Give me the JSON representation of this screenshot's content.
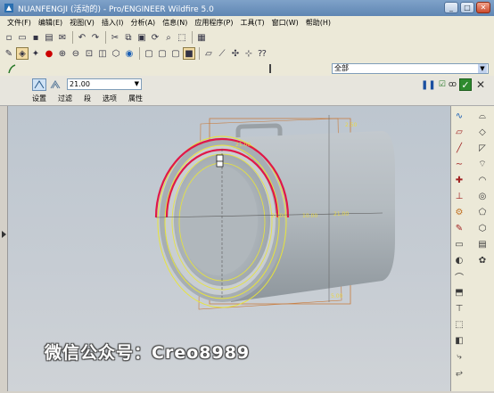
{
  "window": {
    "title": "NUANFENGJI (活动的) - Pro/ENGINEER Wildfire 5.0",
    "minimize": "_",
    "maximize": "□",
    "close": "✕"
  },
  "menu": [
    "文件(F)",
    "编辑(E)",
    "视图(V)",
    "插入(I)",
    "分析(A)",
    "信息(N)",
    "应用程序(P)",
    "工具(T)",
    "窗口(W)",
    "帮助(H)"
  ],
  "filter": {
    "value": "全部"
  },
  "dashboard": {
    "value": "21.00",
    "tabs": [
      "设置",
      "过滤",
      "段",
      "选项",
      "属性"
    ]
  },
  "viewport": {
    "dims": {
      "d1": "21.00",
      "d2": "21.00",
      "d3": "10.00",
      "d4": "21.00",
      "d5": "2.50",
      "d6": "5.00"
    }
  },
  "watermark": "微信公众号：Creo8989",
  "colors": {
    "titlebar": "#5f86b3",
    "model": "#a9b0b6",
    "highlight": "#e01848",
    "sketch": "#e8e43a",
    "datum": "#c87a3a",
    "ok": "#2e8b2e"
  },
  "icons": [
    "new-icon",
    "open-icon",
    "save-icon",
    "print-icon",
    "email-icon",
    "undo-icon",
    "redo-icon",
    "cut-icon",
    "copy-icon",
    "paste-icon",
    "regenerate-icon",
    "find-icon",
    "select-box-icon",
    "zoom-in-icon",
    "zoom-out-icon",
    "refit-icon",
    "repaint-icon",
    "spin-center-icon",
    "view-icon",
    "datum-plane-icon",
    "datum-axis-icon",
    "datum-point-icon",
    "csys-icon",
    "help-icon"
  ]
}
